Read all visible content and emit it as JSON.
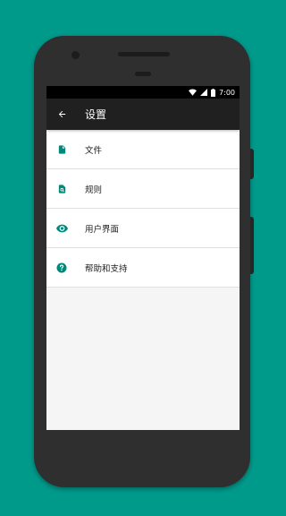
{
  "status_bar": {
    "time": "7:00"
  },
  "toolbar": {
    "title": "设置"
  },
  "settings": {
    "items": [
      {
        "label": "文件",
        "icon": "file-icon"
      },
      {
        "label": "规则",
        "icon": "file-search-icon"
      },
      {
        "label": "用户界面",
        "icon": "eye-icon"
      },
      {
        "label": "帮助和支持",
        "icon": "help-icon"
      }
    ]
  },
  "colors": {
    "accent": "#00897b",
    "background": "#009a8b",
    "toolbar": "#202020"
  }
}
